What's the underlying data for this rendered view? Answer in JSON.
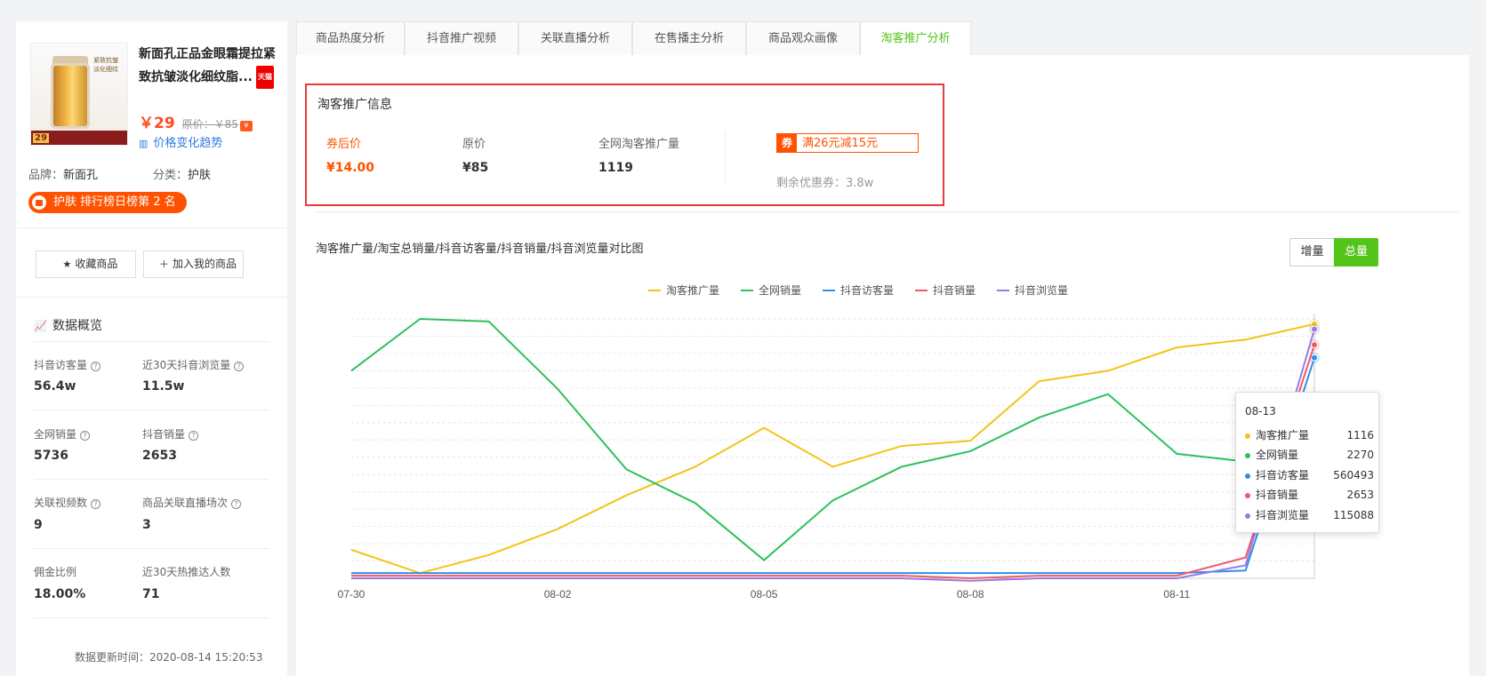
{
  "product": {
    "img_text": "紧致抗皱 淡化细纹",
    "img_badge": "29",
    "tmall_badge": "天猫",
    "title": "新面孔正品金眼霜提拉紧致抗皱淡化细纹脂...",
    "price": "￥29",
    "orig_price": "原价：￥85",
    "coupon_mark": "¥",
    "trend_link": "价格变化趋势",
    "brand_label": "品牌：",
    "brand": "新面孔",
    "category_label": "分类：",
    "category": "护肤",
    "rank_text": "护肤 排行榜日榜第 2 名"
  },
  "actions": {
    "favorite": "收藏商品",
    "add_mine": "加入我的商品"
  },
  "overview": {
    "title": "数据概览",
    "stats": [
      {
        "label": "抖音访客量",
        "value": "56.4w",
        "help": true
      },
      {
        "label": "近30天抖音浏览量",
        "value": "11.5w",
        "help": true
      },
      {
        "label": "全网销量",
        "value": "5736",
        "help": true
      },
      {
        "label": "抖音销量",
        "value": "2653",
        "help": true
      },
      {
        "label": "关联视频数",
        "value": "9",
        "help": true
      },
      {
        "label": "商品关联直播场次",
        "value": "3",
        "help": true
      },
      {
        "label": "佣金比例",
        "value": "18.00%",
        "help": false
      },
      {
        "label": "近30天热推达人数",
        "value": "71",
        "help": false
      }
    ],
    "update_time": "数据更新时间：2020-08-14 15:20:53"
  },
  "tabs": [
    "商品热度分析",
    "抖音推广视频",
    "关联直播分析",
    "在售播主分析",
    "商品观众画像",
    "淘客推广分析"
  ],
  "taoke": {
    "title": "淘客推广信息",
    "after_coupon_label": "券后价",
    "after_coupon_value": "¥14.00",
    "orig_label": "原价",
    "orig_value": "¥85",
    "promo_label": "全网淘客推广量",
    "promo_value": "1119",
    "coupon_tag": "券",
    "coupon_text": "满26元减15元",
    "remain": "剩余优惠券：3.8w"
  },
  "chart_header": {
    "title": "淘客推广量/淘宝总销量/抖音访客量/抖音销量/抖音浏览量对比图",
    "toggle_inc": "增量",
    "toggle_total": "总量"
  },
  "chart_data": {
    "type": "line",
    "x": [
      "07-30",
      "07-31",
      "08-01",
      "08-02",
      "08-03",
      "08-04",
      "08-05",
      "08-06",
      "08-07",
      "08-08",
      "08-09",
      "08-10",
      "08-11",
      "08-12",
      "08-13"
    ],
    "x_tick_labels": [
      "07-30",
      "08-02",
      "08-05",
      "08-08",
      "08-11"
    ],
    "normalized": true,
    "ylim": [
      0,
      1
    ],
    "grid": true,
    "legend": "top-center",
    "series": [
      {
        "name": "淘客推广量",
        "color": "#f5c318",
        "values": [
          0.11,
          0.02,
          0.09,
          0.19,
          0.32,
          0.43,
          0.58,
          0.43,
          0.51,
          0.53,
          0.76,
          0.8,
          0.89,
          0.92,
          0.98
        ]
      },
      {
        "name": "全网销量",
        "color": "#2ec05c",
        "values": [
          0.8,
          1.0,
          0.99,
          0.73,
          0.42,
          0.29,
          0.07,
          0.3,
          0.43,
          0.49,
          0.62,
          0.71,
          0.48,
          0.45,
          0.7
        ]
      },
      {
        "name": "抖音访客量",
        "color": "#2f8fe8",
        "values": [
          0.02,
          0.02,
          0.02,
          0.02,
          0.02,
          0.02,
          0.02,
          0.02,
          0.02,
          0.02,
          0.02,
          0.02,
          0.02,
          0.03,
          0.85
        ]
      },
      {
        "name": "抖音销量",
        "color": "#ee5a6a",
        "values": [
          0.01,
          0.01,
          0.01,
          0.01,
          0.01,
          0.01,
          0.01,
          0.01,
          0.01,
          0.0,
          0.01,
          0.01,
          0.01,
          0.08,
          0.9
        ]
      },
      {
        "name": "抖音浏览量",
        "color": "#9b7be0",
        "values": [
          0.0,
          0.0,
          0.0,
          0.0,
          0.0,
          0.0,
          0.0,
          0.0,
          0.0,
          -0.01,
          0.0,
          0.0,
          0.0,
          0.05,
          0.96
        ]
      }
    ],
    "tooltip": {
      "date": "08-13",
      "values": [
        "1116",
        "2270",
        "560493",
        "2653",
        "115088"
      ]
    }
  }
}
